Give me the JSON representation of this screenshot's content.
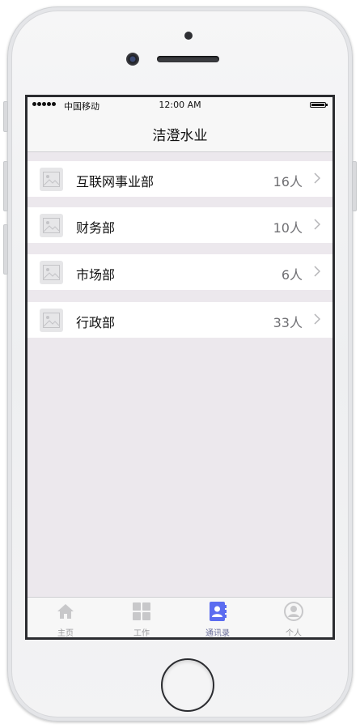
{
  "status_bar": {
    "carrier": "中国移动",
    "time": "12:00 AM"
  },
  "nav": {
    "title": "洁澄水业"
  },
  "departments": [
    {
      "name": "互联网事业部",
      "count": "16人"
    },
    {
      "name": "财务部",
      "count": "10人"
    },
    {
      "name": "市场部",
      "count": "6人"
    },
    {
      "name": "行政部",
      "count": "33人"
    }
  ],
  "tabs": [
    {
      "label": "主页",
      "icon": "home-icon"
    },
    {
      "label": "工作",
      "icon": "grid-icon"
    },
    {
      "label": "通讯录",
      "icon": "contacts-icon",
      "active": true
    },
    {
      "label": "个人",
      "icon": "person-icon"
    }
  ],
  "colors": {
    "accent": "#5b6cf0",
    "background": "#ece8ed",
    "inactive": "#c8c8ca"
  }
}
